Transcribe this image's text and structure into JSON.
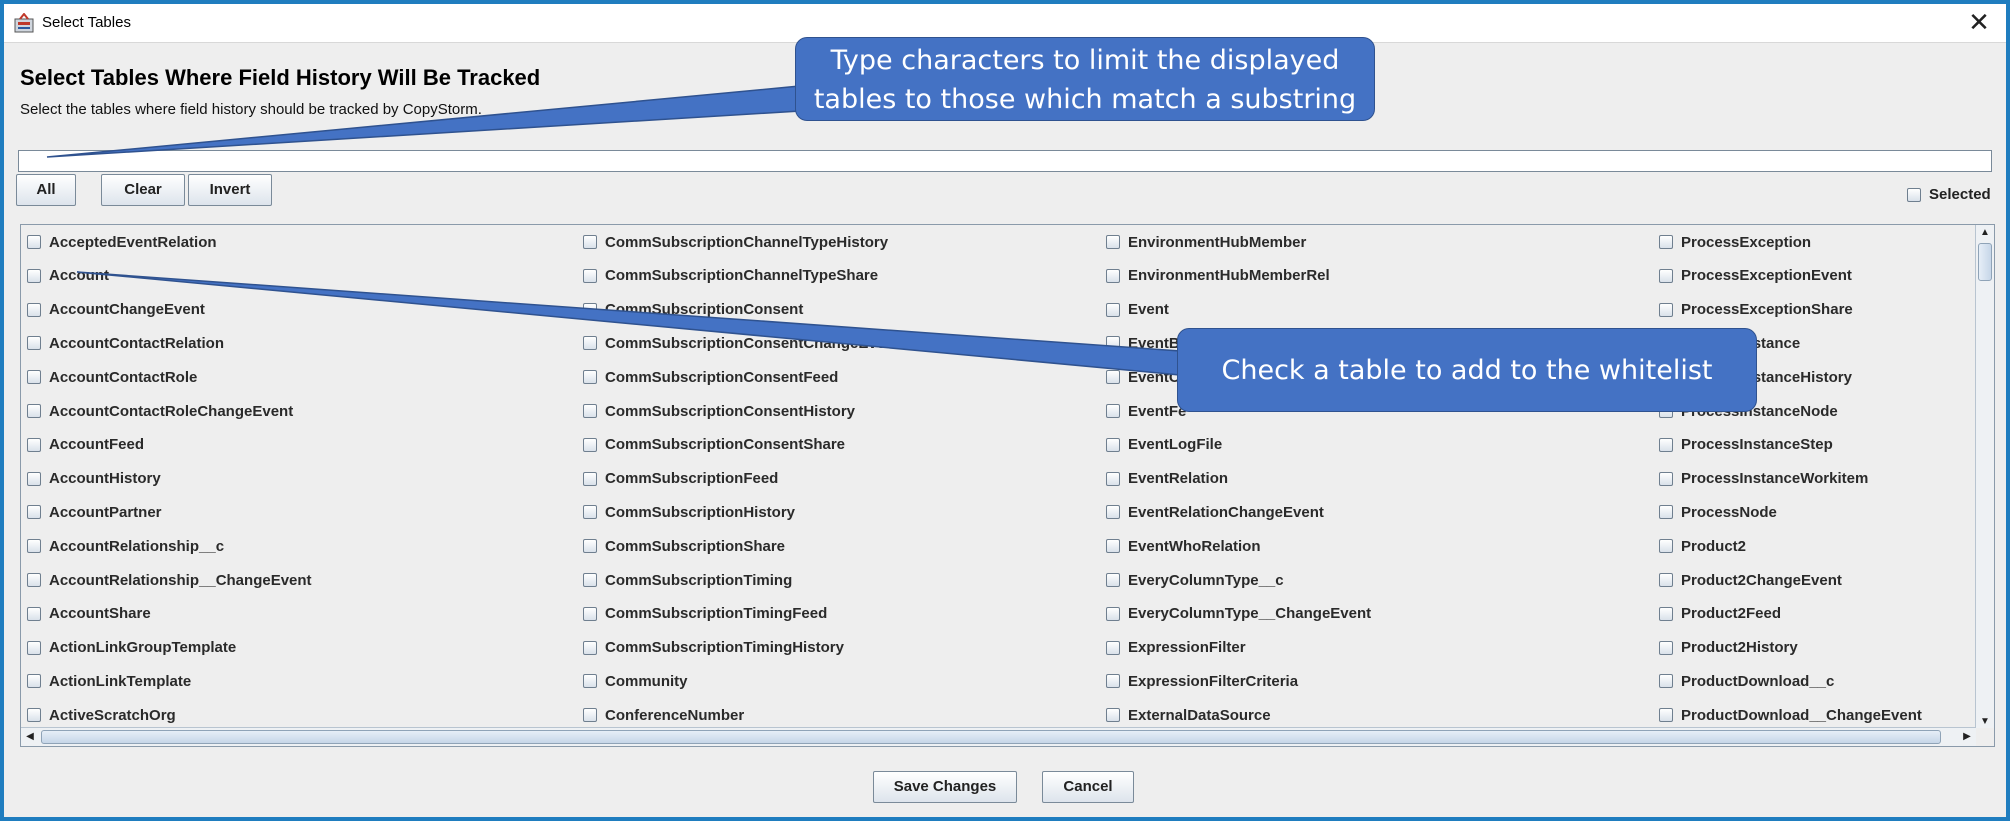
{
  "window": {
    "title": "Select Tables",
    "close_glyph": "✕"
  },
  "header": {
    "title": "Select Tables Where Field History Will Be Tracked",
    "subtitle": "Select the tables where field history should be tracked by CopyStorm."
  },
  "filter": {
    "value": "",
    "placeholder": ""
  },
  "buttons": {
    "all": "All",
    "clear": "Clear",
    "invert": "Invert",
    "save": "Save Changes",
    "cancel": "Cancel"
  },
  "selected_toggle": {
    "label": "Selected",
    "checked": false
  },
  "tables": {
    "columns": [
      [
        "AcceptedEventRelation",
        "Account",
        "AccountChangeEvent",
        "AccountContactRelation",
        "AccountContactRole",
        "AccountContactRoleChangeEvent",
        "AccountFeed",
        "AccountHistory",
        "AccountPartner",
        "AccountRelationship__c",
        "AccountRelationship__ChangeEvent",
        "AccountShare",
        "ActionLinkGroupTemplate",
        "ActionLinkTemplate",
        "ActiveScratchOrg"
      ],
      [
        "CommSubscriptionChannelTypeHistory",
        "CommSubscriptionChannelTypeShare",
        "CommSubscriptionConsent",
        "CommSubscriptionConsentChangeEvent",
        "CommSubscriptionConsentFeed",
        "CommSubscriptionConsentHistory",
        "CommSubscriptionConsentShare",
        "CommSubscriptionFeed",
        "CommSubscriptionHistory",
        "CommSubscriptionShare",
        "CommSubscriptionTiming",
        "CommSubscriptionTimingFeed",
        "CommSubscriptionTimingHistory",
        "Community",
        "ConferenceNumber"
      ],
      [
        "EnvironmentHubMember",
        "EnvironmentHubMemberRel",
        "Event",
        "EventBu",
        "EventCh",
        "EventFe",
        "EventLogFile",
        "EventRelation",
        "EventRelationChangeEvent",
        "EventWhoRelation",
        "EveryColumnType__c",
        "EveryColumnType__ChangeEvent",
        "ExpressionFilter",
        "ExpressionFilterCriteria",
        "ExternalDataSource"
      ],
      [
        "ProcessException",
        "ProcessExceptionEvent",
        "ProcessExceptionShare",
        "ProcessInstance",
        "ProcessInstanceHistory",
        "ProcessInstanceNode",
        "ProcessInstanceStep",
        "ProcessInstanceWorkitem",
        "ProcessNode",
        "Product2",
        "Product2ChangeEvent",
        "Product2Feed",
        "Product2History",
        "ProductDownload__c",
        "ProductDownload__ChangeEvent"
      ]
    ]
  },
  "callouts": {
    "filter_hint": "Type characters to limit the displayed tables to those which match a substring",
    "checkbox_hint": "Check a table to add to the whitelist"
  }
}
